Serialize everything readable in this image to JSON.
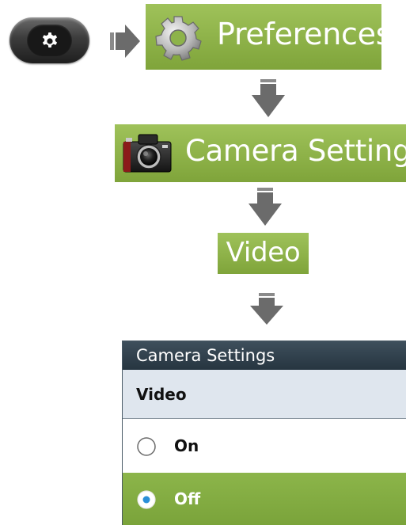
{
  "steps": {
    "hard_key": {
      "icon": "gear-icon"
    },
    "preferences": {
      "label": "Preferences",
      "icon": "gear-icon"
    },
    "camera_settings": {
      "label": "Camera Settings",
      "icon": "camera-icon"
    },
    "video": {
      "label": "Video"
    }
  },
  "screen": {
    "title": "Camera Settings",
    "subtitle": "Video",
    "options": [
      {
        "label": "On",
        "selected": false
      },
      {
        "label": "Off",
        "selected": true
      }
    ]
  },
  "colors": {
    "accent_green": "#8db34a",
    "arrow_gray": "#6b6b6b",
    "title_bar": "#2e3e4a",
    "subheader_bg": "#dfe6ee",
    "radio_blue": "#2a8fd8"
  }
}
